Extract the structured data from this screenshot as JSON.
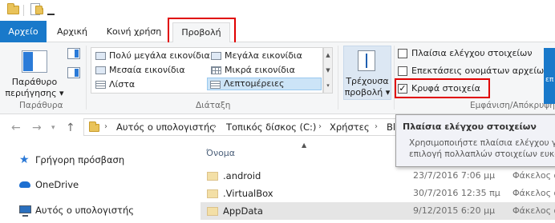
{
  "ribbon_tabs": {
    "file": "Αρχείο",
    "home": "Αρχική",
    "share": "Κοινή χρήση",
    "view": "Προβολή"
  },
  "panes": {
    "navigation_pane_label_1": "Παράθυρο",
    "navigation_pane_label_2": "περιήγησης",
    "dropdown_caret": "▾",
    "group_label": "Παράθυρα"
  },
  "layout": {
    "items": [
      "Πολύ μεγάλα εικονίδια",
      "Μεγάλα εικονίδια",
      "Μεσαία εικονίδια",
      "Μικρά εικονίδια",
      "Λίστα",
      "Λεπτομέρειες"
    ],
    "selected": "Λεπτομέρειες",
    "group_label": "Διάταξη"
  },
  "current_view": {
    "label_1": "Τρέχουσα",
    "label_2": "προβολή",
    "caret": "▾"
  },
  "show_hide": {
    "checkboxes": [
      {
        "label": "Πλαίσια ελέγχου στοιχείων",
        "checked": false
      },
      {
        "label": "Επεκτάσεις ονομάτων αρχείων",
        "checked": false
      },
      {
        "label": "Κρυφά στοιχεία",
        "checked": true
      }
    ],
    "group_label": "Εμφάνιση/Απόκρυψη",
    "blue_button_fragment": "επ"
  },
  "address_bar": {
    "segments": [
      "Αυτός ο υπολογιστής",
      "Τοπικός δίσκος (C:)",
      "Χρήστες",
      "Bl"
    ],
    "separator": "›"
  },
  "tooltip": {
    "title": "Πλαίσια ελέγχου στοιχείων",
    "line_1": "Χρησιμοποιήστε πλαίσια ελέγχου για",
    "line_2": "επιλογή πολλαπλών στοιχείων ευκολ"
  },
  "navigation_pane": {
    "items": [
      {
        "label": "Γρήγορη πρόσβαση",
        "icon": "star-icon"
      },
      {
        "label": "OneDrive",
        "icon": "cloud-icon"
      },
      {
        "label": "Αυτός ο υπολογιστής",
        "icon": "computer-icon"
      }
    ]
  },
  "file_list": {
    "column_name": "Όνομα",
    "rows": [
      {
        "name": ".android",
        "date": "23/7/2016 7:06 μμ",
        "type": "Φάκελος αρ"
      },
      {
        "name": ".VirtualBox",
        "date": "30/7/2016 12:35 πμ",
        "type": "Φάκελος αρ"
      },
      {
        "name": "AppData",
        "date": "9/12/2015 6:20 μμ",
        "type": "Φάκελος αρ"
      }
    ]
  },
  "colors": {
    "file_tab": "#1979ca",
    "highlight_box": "#e00000",
    "selection": "#cce4f7",
    "folder": "#e9c35a"
  }
}
